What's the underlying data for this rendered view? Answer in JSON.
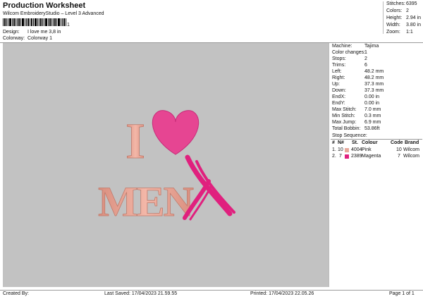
{
  "header": {
    "title": "Production Worksheet",
    "subtitle": "Wilcom EmbroideryStudio – Level 3 Advanced",
    "barcode_number": "1",
    "design_label": "Design:",
    "design_value": "I love me 3,8 in",
    "colorway_label": "Colorway:",
    "colorway_value": "Colorway 1"
  },
  "stats": [
    {
      "label": "Stitches:",
      "value": "6395"
    },
    {
      "label": "Colors:",
      "value": "2"
    },
    {
      "label": "Height:",
      "value": "2.94 in"
    },
    {
      "label": "Width:",
      "value": "3.80 in"
    },
    {
      "label": "Zoom:",
      "value": "1:1"
    }
  ],
  "design_preview": {
    "line1_letter": "I",
    "line2_text": "MEN",
    "thread_colors": {
      "pink": "#e8a89a",
      "magenta": "#e0207e",
      "heart": "#e64592",
      "background": "#c2c2c2"
    }
  },
  "machine_info": [
    {
      "label": "Machine:",
      "value": "Tajima"
    },
    {
      "label": "Color changes:",
      "value": "1"
    },
    {
      "label": "Stops:",
      "value": "2"
    },
    {
      "label": "Trims:",
      "value": "6"
    },
    {
      "label": "Left:",
      "value": "48.2 mm"
    },
    {
      "label": "Right:",
      "value": "48.2 mm"
    },
    {
      "label": "Up:",
      "value": "37.3 mm"
    },
    {
      "label": "Down:",
      "value": "37.3 mm"
    },
    {
      "label": "EndX:",
      "value": "0.00 in"
    },
    {
      "label": "EndY:",
      "value": "0.00 in"
    },
    {
      "label": "Max Stitch:",
      "value": "7.0 mm"
    },
    {
      "label": "Min Stitch:",
      "value": "0.3 mm"
    },
    {
      "label": "Max Jump:",
      "value": "6.9 mm"
    },
    {
      "label": "Total Bobbin:",
      "value": "53.86ft"
    }
  ],
  "stop_sequence": {
    "title": "Stop Sequence:",
    "headers": [
      "#",
      "N#",
      "St.",
      "Colour",
      "Code",
      "Brand"
    ],
    "rows": [
      {
        "num": "1.",
        "n": "10",
        "code": "4004",
        "colour": "Pink",
        "code2": "10",
        "brand": "Wilcom",
        "swatch": "#e8a89a"
      },
      {
        "num": "2.",
        "n": "7",
        "code": "2389",
        "colour": "Magenta",
        "code2": "7",
        "brand": "Wilcom",
        "swatch": "#e0207e"
      }
    ]
  },
  "footer": {
    "created_by": "Created By:",
    "last_saved": "Last Saved: 17/04/2023 21.59.55",
    "printed": "Printed: 17/04/2023 22.05.26",
    "page": "Page 1 of 1"
  }
}
